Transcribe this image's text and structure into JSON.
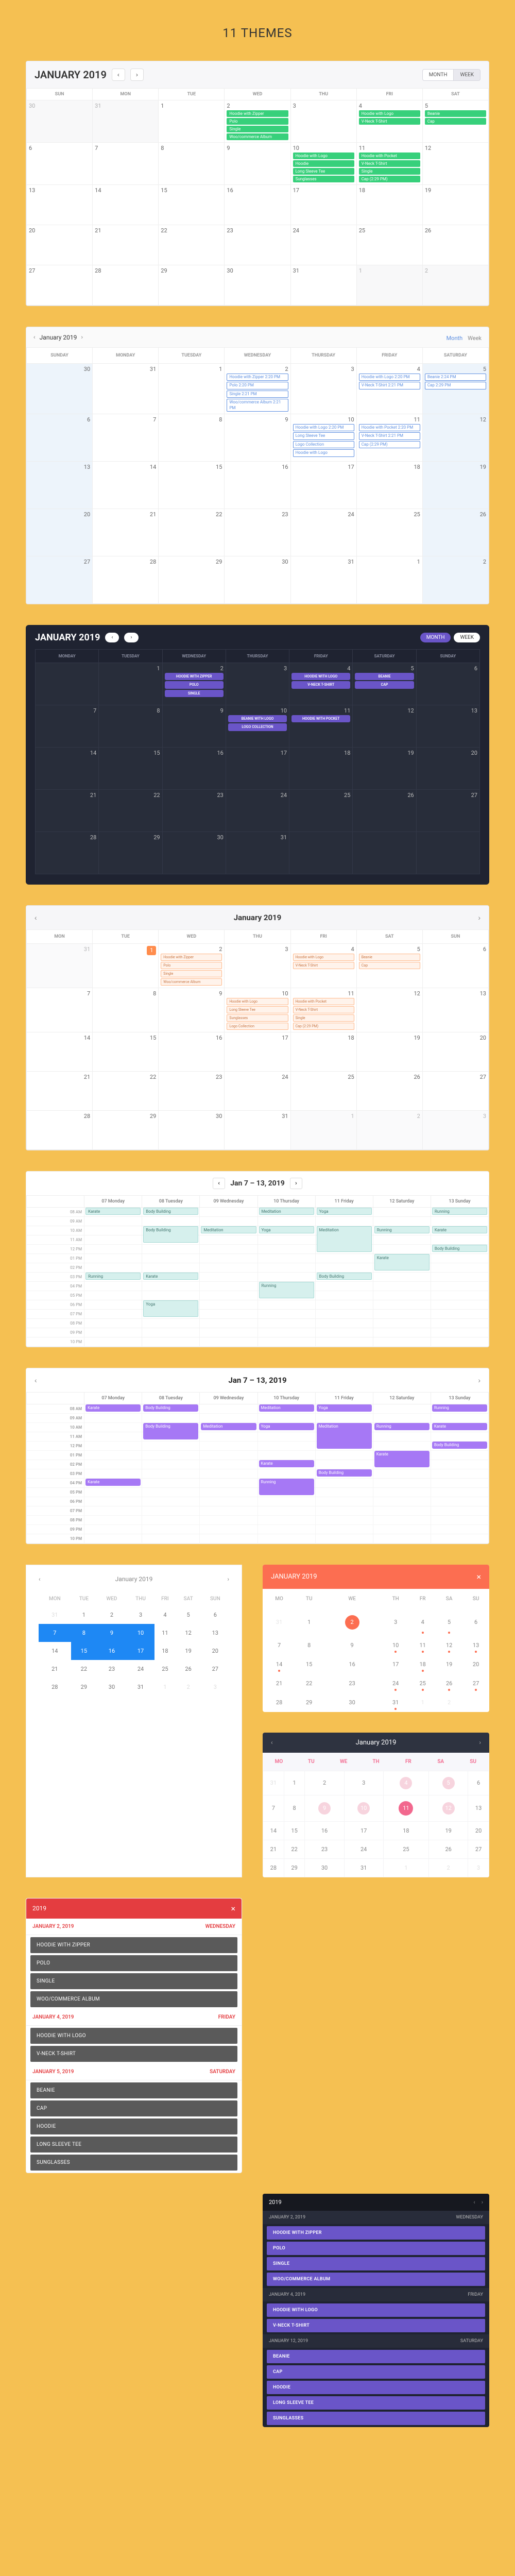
{
  "page_title": "11 THEMES",
  "jan2019_weekday_start": 2,
  "months": {
    "jan2019": "JANUARY 2019",
    "jan2019_cap": "January 2019"
  },
  "view_labels": {
    "month": "MONTH",
    "week": "WEEK",
    "month_sm": "Month",
    "week_sm": "Week"
  },
  "weekdays7": [
    "SUN",
    "MON",
    "TUE",
    "WED",
    "THU",
    "FRI",
    "SAT"
  ],
  "weekdays_full": [
    "SUNDAY",
    "MONDAY",
    "TUESDAY",
    "WEDNESDAY",
    "THURSDAY",
    "FRIDAY",
    "SATURDAY"
  ],
  "weekdays_mon": [
    "MON",
    "TUE",
    "WED",
    "THU",
    "FRI",
    "SAT",
    "SUN"
  ],
  "weekdays_mon_lc": [
    "MONDAY",
    "TUESDAY",
    "WEDNESDAY",
    "THURSDAY",
    "FRIDAY",
    "SATURDAY",
    "SUNDAY"
  ],
  "dec_tail": [
    30,
    31
  ],
  "feb_head": [
    1,
    2
  ],
  "cal1": {
    "events": {
      "2": [
        "Hoodie with Zipper",
        "Polo",
        "Single",
        "Woo/commerce Album"
      ],
      "4": [
        "Hoodie with Logo",
        "V-Neck T-Shirt"
      ],
      "5": [
        "Beanie",
        "Cap"
      ],
      "10": [
        "Hoodie with Logo",
        "Hoodie",
        "Long Sleeve Tee",
        "Sunglasses"
      ],
      "11": [
        "Hoodie with Pocket",
        "V-Neck T-Shirt",
        "Single",
        "Cap (2:29 PM)"
      ]
    }
  },
  "cal2": {
    "events": {
      "2": [
        "Hoodie with Zipper 2:20 PM",
        "Polo 2:20 PM",
        "Single 2:21 PM",
        "Woo/commerce Album 2:21 PM"
      ],
      "4": [
        "Hoodie with Logo 2:20 PM",
        "V-Neck T-Shirt 2:21 PM"
      ],
      "5": [
        "Beanie 2:24 PM",
        "Cap 2:29 PM"
      ],
      "10": [
        "Hoodie with Logo 2:20 PM",
        "Long Sleeve Tee",
        "Logo Collection",
        "Hoodie with Logo"
      ],
      "11": [
        "Hoodie with Pocket 2:20 PM",
        "V-Neck T-Shirt 2:21 PM",
        "Cap (2:29 PM)"
      ]
    }
  },
  "cal3": {
    "weekdays": [
      "MONDAY",
      "TUESDAY",
      "WEDNESDAY",
      "THURSDAY",
      "FRIDAY",
      "SATURDAY",
      "SUNDAY"
    ],
    "events": {
      "2": [
        "HOODIE WITH ZIPPER",
        "POLO",
        "SINGLE"
      ],
      "4": [
        "HOODIE WITH LOGO",
        "V-NECK T-SHIRT"
      ],
      "5": [
        "BEANIE",
        "CAP"
      ],
      "10": [
        "BEANIE WITH LOGO",
        "LOGO COLLECTION"
      ],
      "11": [
        "HOODIE WITH POCKET"
      ]
    }
  },
  "cal4": {
    "today": 1,
    "events": {
      "2": [
        "Hoodie with Zipper",
        "Polo",
        "Single",
        "Woo/commerce Album"
      ],
      "4": [
        "Hoodie with Logo",
        "V-Neck T-Shirt"
      ],
      "5": [
        "Beanie",
        "Cap"
      ],
      "10": [
        "Hoodie with Logo",
        "Long Sleeve Tee",
        "Sunglasses",
        "Logo Collection"
      ],
      "11": [
        "Hoodie with Pocket",
        "V-Neck T-Shirt",
        "Single",
        "Cap (2:29 PM)"
      ]
    }
  },
  "week_title": "Jan 7 – 13, 2019",
  "week_days": [
    "07 Monday",
    "08 Tuesday",
    "09 Wednesday",
    "10 Thursday",
    "11 Friday",
    "12 Saturday",
    "13 Sunday"
  ],
  "hours": [
    "08 AM",
    "09 AM",
    "10 AM",
    "11 AM",
    "12 PM",
    "01 PM",
    "02 PM",
    "03 PM",
    "04 PM",
    "05 PM",
    "06 PM",
    "07 PM",
    "08 PM",
    "09 PM",
    "10 PM"
  ],
  "cal5_blocks": [
    {
      "day": 0,
      "start": 0,
      "span": 1,
      "label": "Karate"
    },
    {
      "day": 1,
      "start": 0,
      "span": 1,
      "label": "Body Building"
    },
    {
      "day": 3,
      "start": 0,
      "span": 1,
      "label": "Meditation"
    },
    {
      "day": 4,
      "start": 0,
      "span": 1,
      "label": "Yoga"
    },
    {
      "day": 6,
      "start": 0,
      "span": 1,
      "label": "Running"
    },
    {
      "day": 1,
      "start": 2,
      "span": 2,
      "label": "Body Building"
    },
    {
      "day": 2,
      "start": 2,
      "span": 1,
      "label": "Meditation"
    },
    {
      "day": 3,
      "start": 2,
      "span": 1,
      "label": "Yoga"
    },
    {
      "day": 4,
      "start": 2,
      "span": 3,
      "label": "Meditation"
    },
    {
      "day": 5,
      "start": 2,
      "span": 1,
      "label": "Running"
    },
    {
      "day": 6,
      "start": 2,
      "span": 1,
      "label": "Karate"
    },
    {
      "day": 6,
      "start": 4,
      "span": 1,
      "label": "Body Building"
    },
    {
      "day": 5,
      "start": 5,
      "span": 2,
      "label": "Karate"
    },
    {
      "day": 0,
      "start": 7,
      "span": 1,
      "label": "Running"
    },
    {
      "day": 1,
      "start": 7,
      "span": 1,
      "label": "Karate"
    },
    {
      "day": 4,
      "start": 7,
      "span": 1,
      "label": "Body Building"
    },
    {
      "day": 3,
      "start": 8,
      "span": 2,
      "label": "Running"
    },
    {
      "day": 1,
      "start": 10,
      "span": 2,
      "label": "Yoga"
    }
  ],
  "cal6_blocks": [
    {
      "day": 0,
      "start": 0,
      "span": 1,
      "label": "Karate"
    },
    {
      "day": 1,
      "start": 0,
      "span": 1,
      "label": "Body Building"
    },
    {
      "day": 3,
      "start": 0,
      "span": 1,
      "label": "Meditation"
    },
    {
      "day": 4,
      "start": 0,
      "span": 1,
      "label": "Yoga"
    },
    {
      "day": 6,
      "start": 0,
      "span": 1,
      "label": "Running"
    },
    {
      "day": 1,
      "start": 2,
      "span": 2,
      "label": "Body Building"
    },
    {
      "day": 2,
      "start": 2,
      "span": 1,
      "label": "Meditation"
    },
    {
      "day": 3,
      "start": 2,
      "span": 1,
      "label": "Yoga"
    },
    {
      "day": 4,
      "start": 2,
      "span": 3,
      "label": "Meditation"
    },
    {
      "day": 5,
      "start": 2,
      "span": 1,
      "label": "Running"
    },
    {
      "day": 6,
      "start": 2,
      "span": 1,
      "label": "Karate"
    },
    {
      "day": 6,
      "start": 4,
      "span": 1,
      "label": "Body Building"
    },
    {
      "day": 5,
      "start": 5,
      "span": 2,
      "label": "Karate"
    },
    {
      "day": 3,
      "start": 6,
      "span": 1,
      "label": "Karate"
    },
    {
      "day": 0,
      "start": 8,
      "span": 1,
      "label": "Karate"
    },
    {
      "day": 4,
      "start": 7,
      "span": 1,
      "label": "Body Building"
    },
    {
      "day": 3,
      "start": 8,
      "span": 2,
      "label": "Running"
    }
  ],
  "cal7": {
    "title": "January 2019",
    "selected": [
      7,
      8,
      9,
      10,
      15,
      16,
      17
    ]
  },
  "cal8": {
    "title": "JANUARY 2019",
    "weekdays": [
      "MO",
      "TU",
      "WE",
      "TH",
      "FR",
      "SA",
      "SU"
    ],
    "selected": [
      2
    ],
    "has_ev": [
      4,
      5,
      10,
      11,
      12,
      13,
      14,
      18,
      24,
      25,
      26,
      27,
      31
    ],
    "dim_tail": [
      1,
      2
    ]
  },
  "cal9": {
    "title": "January 2019",
    "weekdays": [
      "MO",
      "TU",
      "WE",
      "TH",
      "FR",
      "SA",
      "SU"
    ],
    "today": 11,
    "dim_circ": [
      4,
      5,
      9,
      10,
      12
    ]
  },
  "cal10": {
    "title": "2019",
    "days": [
      {
        "date": "JANUARY 2, 2019",
        "dow": "WEDNESDAY",
        "items": [
          "HOODIE WITH ZIPPER",
          "POLO",
          "SINGLE",
          "WOO/COMMERCE ALBUM"
        ]
      },
      {
        "date": "JANUARY 4, 2019",
        "dow": "FRIDAY",
        "items": [
          "HOODIE WITH LOGO",
          "V-NECK T-SHIRT"
        ]
      },
      {
        "date": "JANUARY 5, 2019",
        "dow": "SATURDAY",
        "items": [
          "BEANIE",
          "CAP",
          "HOODIE",
          "LONG SLEEVE TEE",
          "SUNGLASSES"
        ]
      }
    ]
  },
  "cal11": {
    "title": "2019",
    "days": [
      {
        "date": "JANUARY 2, 2019",
        "dow": "WEDNESDAY",
        "items": [
          "HOODIE WITH ZIPPER",
          "POLO",
          "SINGLE",
          "WOO/COMMERCE ALBUM"
        ]
      },
      {
        "date": "JANUARY 4, 2019",
        "dow": "FRIDAY",
        "items": [
          "HOODIE WITH LOGO",
          "V-NECK T-SHIRT"
        ]
      },
      {
        "date": "JANUARY 12, 2019",
        "dow": "SATURDAY",
        "items": [
          "BEANIE",
          "CAP",
          "HOODIE",
          "LONG SLEEVE TEE",
          "SUNGLASSES"
        ]
      }
    ]
  }
}
